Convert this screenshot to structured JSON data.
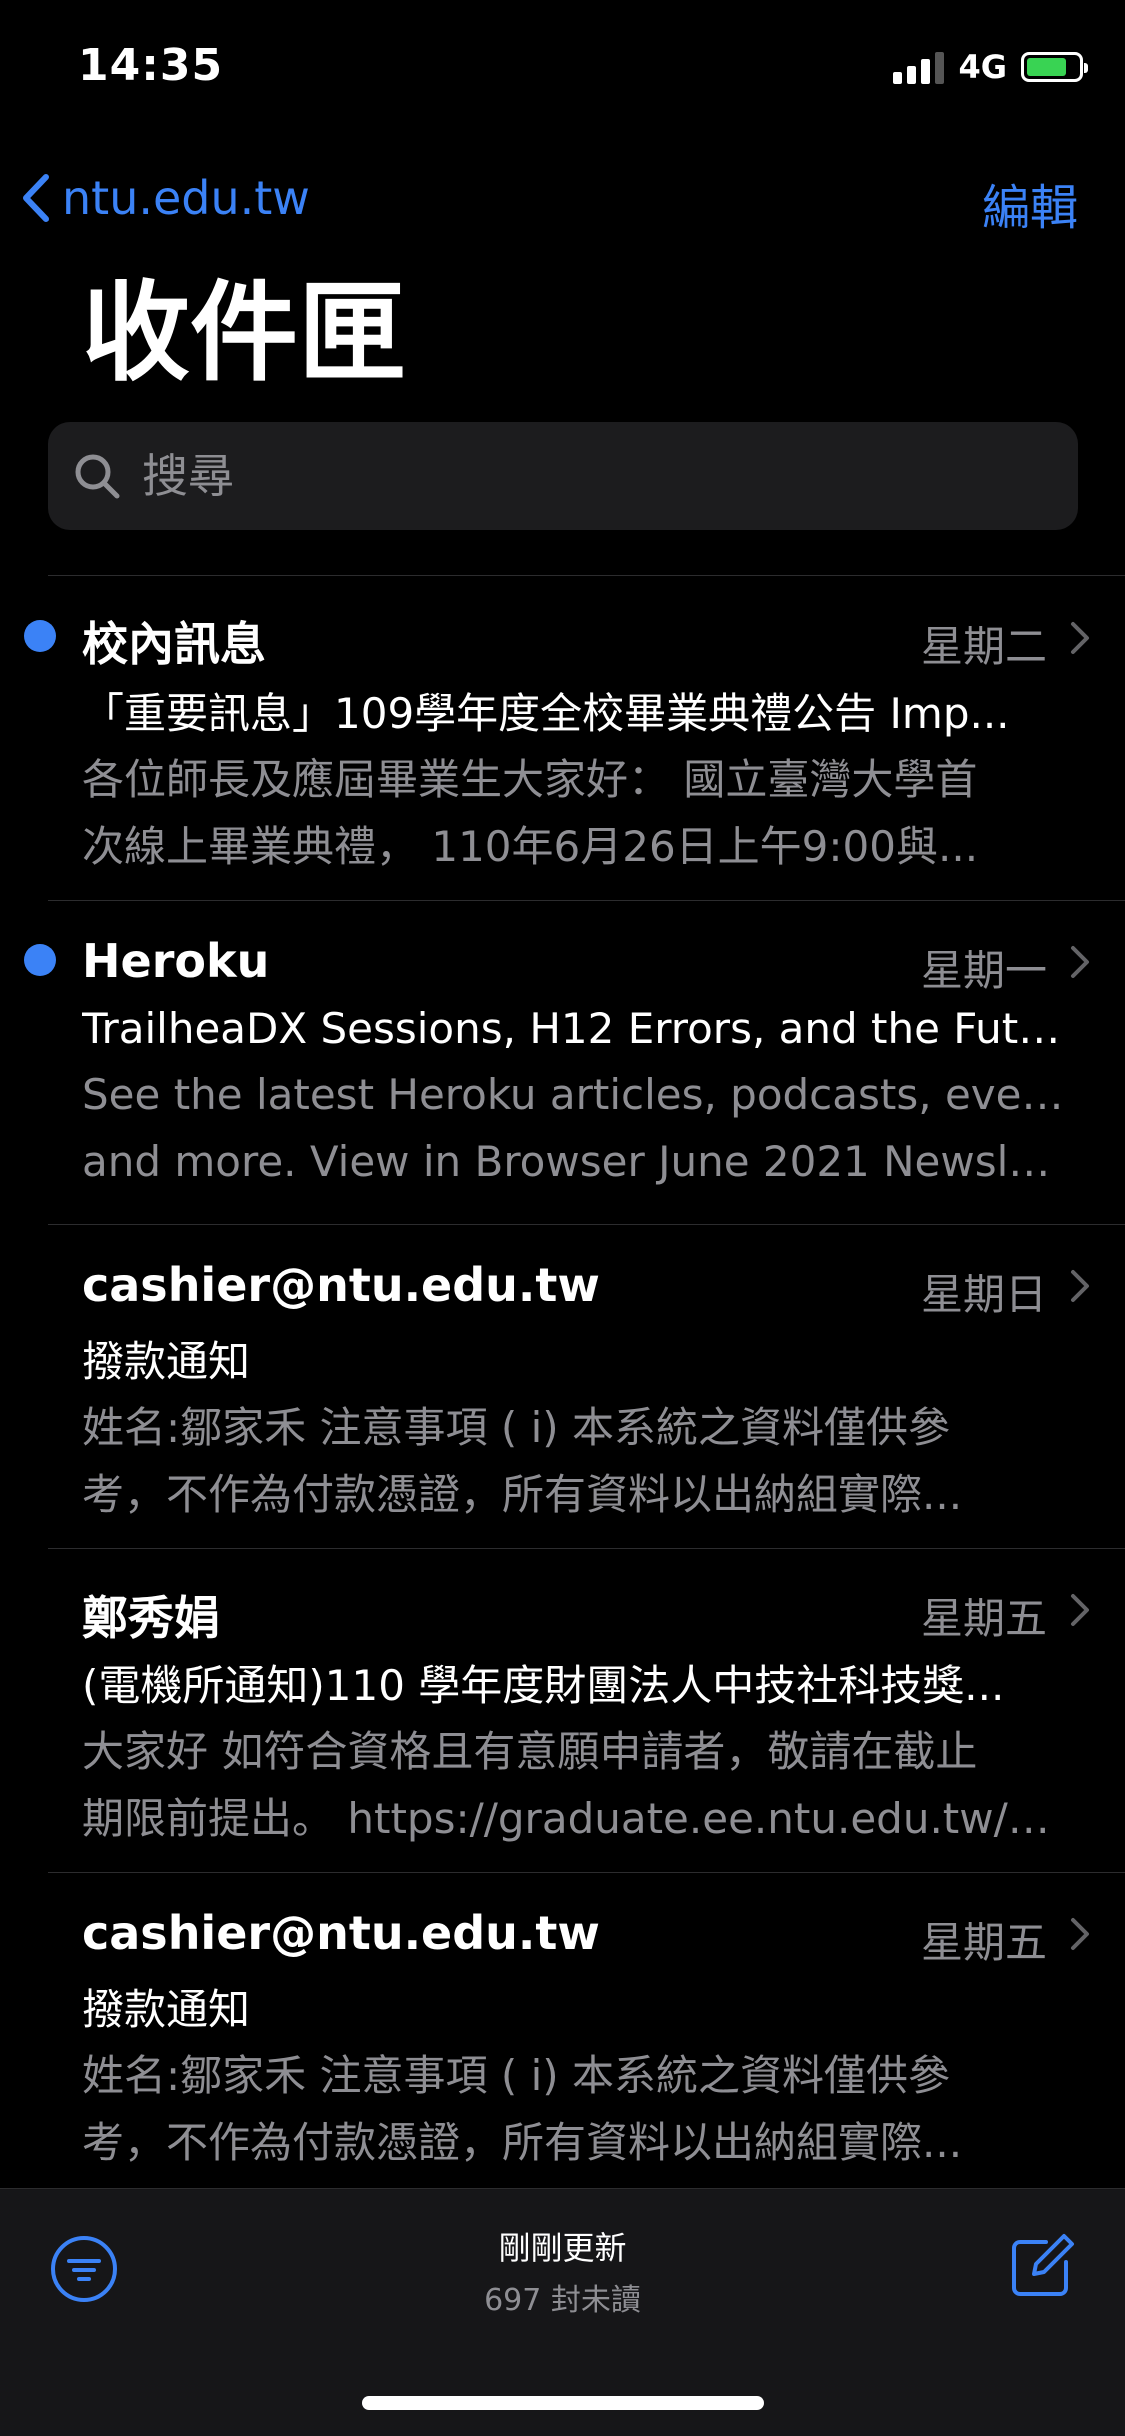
{
  "status_bar": {
    "time": "14:35",
    "network": "4G"
  },
  "nav": {
    "back_label": "ntu.edu.tw",
    "edit_label": "編輯"
  },
  "title": "收件匣",
  "search": {
    "placeholder": "搜尋"
  },
  "mails": [
    {
      "sender": "校內訊息",
      "date": "星期二",
      "unread": true,
      "subject": "「重要訊息」109學年度全校畢業典禮公告 Imp...",
      "preview": [
        "各位師長及應屆畢業生大家好： 國立臺灣大學首",
        "次線上畢業典禮， 110年6月26日上午9:00與..."
      ]
    },
    {
      "sender": "Heroku",
      "date": "星期一",
      "unread": true,
      "subject": "TrailheaDX Sessions, H12 Errors, and the Futur...",
      "preview": [
        "See the latest Heroku articles, podcasts, events,",
        "and more. View in Browser June 2021 Newslet..."
      ]
    },
    {
      "sender": "cashier@ntu.edu.tw",
      "date": "星期日",
      "unread": false,
      "subject": "撥款通知",
      "preview": [
        "姓名:鄒家禾 注意事項 ( i) 本系統之資料僅供參",
        "考，不作為付款憑證，所有資料以出納組實際..."
      ]
    },
    {
      "sender": "鄭秀娟",
      "date": "星期五",
      "unread": false,
      "subject": "(電機所通知)110 學年度財團法人中技社科技獎...",
      "preview": [
        "大家好 如符合資格且有意願申請者，敬請在截止",
        "期限前提出。 https://graduate.ee.ntu.edu.tw/#..."
      ]
    },
    {
      "sender": "cashier@ntu.edu.tw",
      "date": "星期五",
      "unread": false,
      "subject": "撥款通知",
      "preview": [
        "姓名:鄒家禾 注意事項 ( i) 本系統之資料僅供參",
        "考，不作為付款憑證，所有資料以出納組實際..."
      ]
    }
  ],
  "toolbar": {
    "status_line1": "剛剛更新",
    "status_line2": "697 封未讀"
  },
  "colors": {
    "accent": "#3b82f6",
    "background": "#000000",
    "secondary_text": "#8e8e93"
  },
  "icons": [
    "back-chevron-icon",
    "search-icon",
    "chevron-right-icon",
    "filter-icon",
    "compose-icon"
  ]
}
